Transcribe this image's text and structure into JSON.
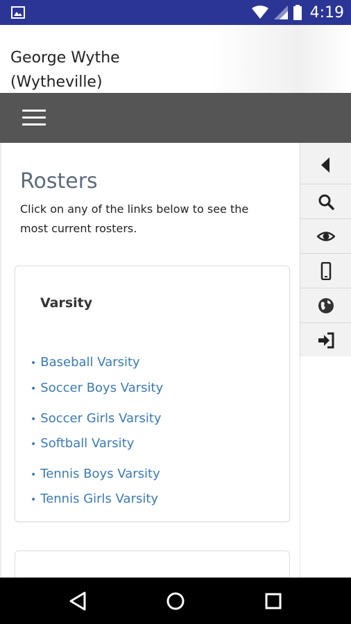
{
  "status_bar": {
    "time": "4:19",
    "icons": [
      "image-icon",
      "wifi-icon",
      "signal-icon",
      "battery-icon"
    ]
  },
  "header": {
    "title_line1": "George Wythe",
    "title_line2": "(Wytheville)"
  },
  "nav": {
    "menu_icon": "hamburger-menu-icon"
  },
  "page": {
    "heading": "Rosters",
    "intro": "Click on any of the links below to see the most current rosters."
  },
  "varsity_card": {
    "title": "Varsity",
    "links": [
      {
        "label": "Baseball Varsity"
      },
      {
        "label": "Soccer Boys Varsity"
      },
      {
        "label": "Soccer Girls Varsity"
      },
      {
        "label": "Softball Varsity"
      },
      {
        "label": "Tennis Boys Varsity"
      },
      {
        "label": "Tennis Girls Varsity"
      }
    ]
  },
  "side_toolbar": {
    "icons": [
      "collapse-arrow-icon",
      "search-icon",
      "eye-icon",
      "mobile-phone-icon",
      "globe-icon",
      "sign-in-icon"
    ]
  },
  "android_nav": {
    "icons": [
      "back-icon",
      "home-icon",
      "recents-icon"
    ]
  },
  "colors": {
    "status_bar": "#2b3595",
    "nav_bar": "#555555",
    "link": "#3a7ab6",
    "heading": "#5d6b7b"
  }
}
